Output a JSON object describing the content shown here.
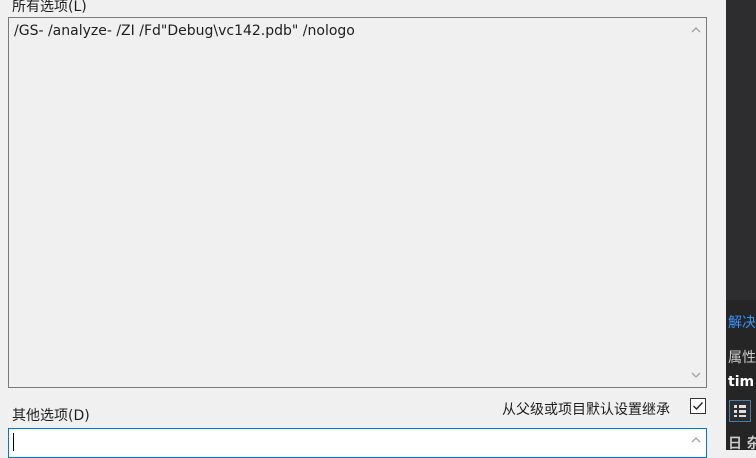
{
  "dialog": {
    "all_options_label": "所有选项(L)",
    "all_options_value": "/GS- /analyze- /ZI /Fd\"Debug\\vc142.pdb\" /nologo",
    "other_options_label": "其他选项(D)",
    "other_options_value": "",
    "inherit_label": "从父级或项目默认设置继承",
    "inherit_checked": true
  },
  "side_panel": {
    "solution_text": "解决",
    "properties_text": "属性",
    "item_text": "tim",
    "misc_text": "日 杂"
  },
  "colors": {
    "accent": "#0078d7",
    "panel_bg": "#252526",
    "link": "#3794ff"
  }
}
